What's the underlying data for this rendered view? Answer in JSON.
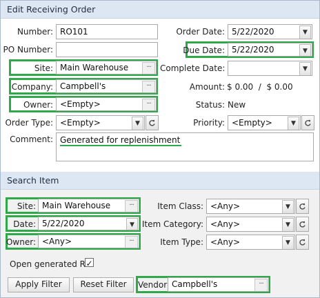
{
  "title": "Edit Receiving Order",
  "order": {
    "number_label": "Number:",
    "number": "RO101",
    "po_label": "PO Number:",
    "po": "",
    "site_label": "Site:",
    "site": "Main Warehouse",
    "company_label": "Company:",
    "company": "Campbell's",
    "owner_label": "Owner:",
    "owner": "<Empty>",
    "order_type_label": "Order Type:",
    "order_type": "<Empty>",
    "comment_label": "Comment:",
    "comment": "Generated for replenishment",
    "order_date_label": "Order Date:",
    "order_date": "5/22/2020",
    "due_date_label": "Due Date:",
    "due_date": "5/22/2020",
    "complete_date_label": "Complete Date:",
    "complete_date": "",
    "amount_label": "Amount:",
    "amount": "$ 0.00  /  $ 0.00",
    "status_label": "Status:",
    "status": "New",
    "priority_label": "Priority:",
    "priority": "<Empty>"
  },
  "search": {
    "title": "Search Item",
    "site_label": "Site:",
    "site": "Main Warehouse",
    "date_label": "Date:",
    "date": "5/22/2020",
    "owner_label": "Owner:",
    "owner": "<Any>",
    "item_class_label": "Item Class:",
    "item_class": "<Any>",
    "item_category_label": "Item Category:",
    "item_category": "<Any>",
    "item_type_label": "Item Type:",
    "item_type": "<Any>",
    "open_generated_label": "Open generated RO",
    "open_generated_checked": "✓",
    "apply_label": "Apply Filter",
    "reset_label": "Reset Filter",
    "vendor_label": "Vendor:",
    "vendor": "Campbell's"
  },
  "icons": {
    "dropdown": "chevron-down-icon",
    "ellipsis": "ellipsis-icon",
    "refresh": "refresh-icon"
  },
  "colors": {
    "highlight": "#2fa84a",
    "header_bg": "#dce7f3",
    "panel_bg": "#f1f1f1"
  }
}
